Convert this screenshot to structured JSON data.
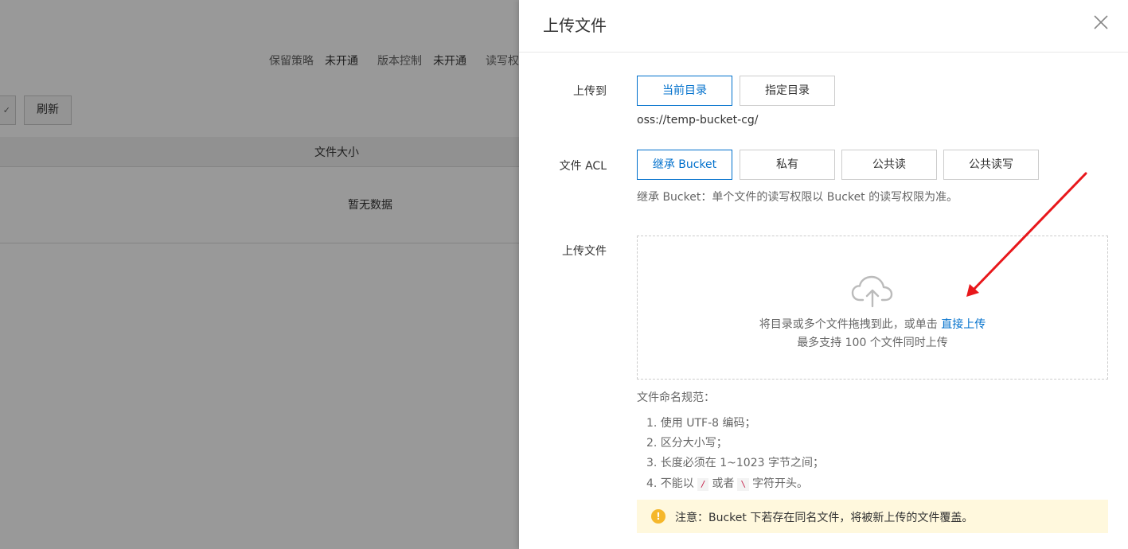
{
  "background": {
    "info": [
      {
        "label": "保留策略",
        "value": "未开通"
      },
      {
        "label": "版本控制",
        "value": "未开通"
      },
      {
        "label": "读写权",
        "value": ""
      }
    ],
    "refresh_label": "刷新",
    "column_header": "文件大小",
    "empty_text": "暂无数据"
  },
  "drawer": {
    "title": "上传文件",
    "upload_to": {
      "label": "上传到",
      "options": [
        "当前目录",
        "指定目录"
      ],
      "selected": "当前目录",
      "path": "oss://temp-bucket-cg/"
    },
    "acl": {
      "label": "文件 ACL",
      "options": [
        "继承 Bucket",
        "私有",
        "公共读",
        "公共读写"
      ],
      "selected": "继承 Bucket",
      "hint": "继承 Bucket：单个文件的读写权限以 Bucket 的读写权限为准。"
    },
    "upload_file": {
      "label": "上传文件",
      "drop_text": "将目录或多个文件拖拽到此，或单击",
      "drop_link": "直接上传",
      "drop_limit": "最多支持 100 个文件同时上传"
    },
    "naming": {
      "title": "文件命名规范：",
      "rule1": "1. 使用 UTF-8 编码；",
      "rule2": "2. 区分大小写；",
      "rule3": "3. 长度必须在 1~1023 字节之间；",
      "rule4_prefix": "4. 不能以",
      "rule4_code1": "/",
      "rule4_mid": "或者",
      "rule4_code2": "\\",
      "rule4_suffix": "字符开头。"
    },
    "notice": "注意：Bucket 下若存在同名文件，将被新上传的文件覆盖。"
  },
  "colors": {
    "accent": "#0070cc",
    "annotation_arrow": "#e8171b",
    "warning": "#f5b72b",
    "notice_bg": "#fff8dd"
  }
}
